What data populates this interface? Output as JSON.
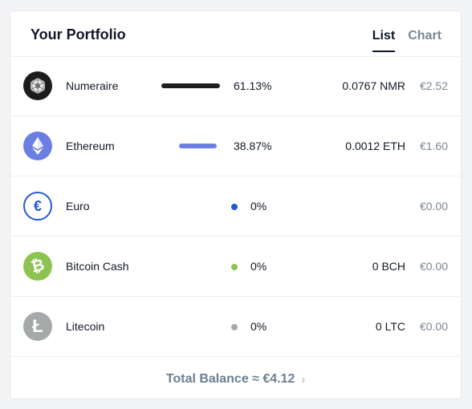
{
  "header": {
    "title": "Your Portfolio",
    "tabs": [
      {
        "label": "List",
        "active": true
      },
      {
        "label": "Chart",
        "active": false
      }
    ]
  },
  "assets": [
    {
      "name": "Numeraire",
      "percent": "61.13%",
      "fraction": 0.6113,
      "bar_color": "#1f1f1f",
      "amount": "0.0767 NMR",
      "value": "€2.52",
      "icon": "numeraire-icon"
    },
    {
      "name": "Ethereum",
      "percent": "38.87%",
      "fraction": 0.3887,
      "bar_color": "#6b7fe3",
      "amount": "0.0012 ETH",
      "value": "€1.60",
      "icon": "ethereum-icon"
    },
    {
      "name": "Euro",
      "percent": "0%",
      "fraction": 0,
      "bar_color": "#2457d6",
      "amount": "",
      "value": "€0.00",
      "icon": "euro-icon"
    },
    {
      "name": "Bitcoin Cash",
      "percent": "0%",
      "fraction": 0,
      "bar_color": "#8dc351",
      "amount": "0 BCH",
      "value": "€0.00",
      "icon": "bitcoin-cash-icon"
    },
    {
      "name": "Litecoin",
      "percent": "0%",
      "fraction": 0,
      "bar_color": "#a6a9aa",
      "amount": "0 LTC",
      "value": "€0.00",
      "icon": "litecoin-icon"
    }
  ],
  "footer": {
    "total_label": "Total Balance ≈ €4.12",
    "chevron": "›"
  }
}
